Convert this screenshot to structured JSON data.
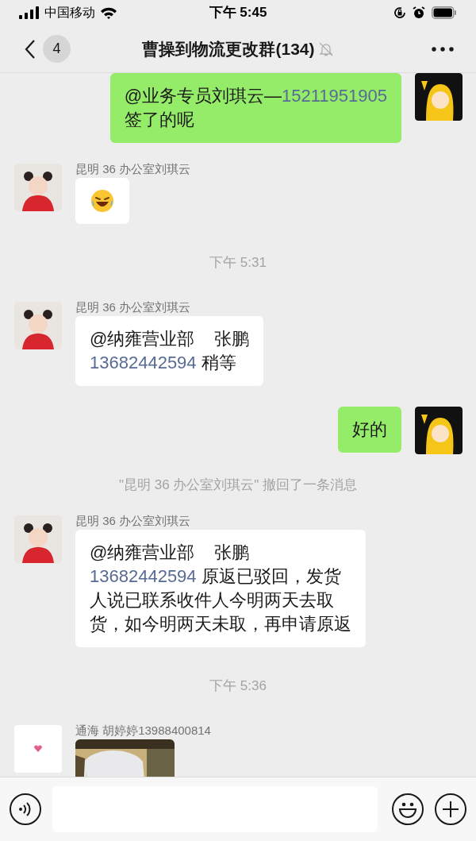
{
  "status_bar": {
    "carrier": "中国移动",
    "time": "下午 5:45"
  },
  "header": {
    "unread": "4",
    "title": "曹操到物流更改群(134)",
    "muted": true
  },
  "messages": [
    {
      "kind": "outgoing",
      "avatar": {
        "kind": "cartoon"
      },
      "lines": [
        [
          {
            "text": "@业务专员刘琪云—"
          },
          {
            "text": "15211951905",
            "link": true
          }
        ],
        [
          {
            "text": "签了的呢"
          }
        ]
      ]
    },
    {
      "kind": "sticker",
      "sender": "昆明 36 办公室刘琪云",
      "avatar": {
        "kind": "girl"
      }
    },
    {
      "kind": "time",
      "text": "下午 5:31"
    },
    {
      "kind": "incoming",
      "sender": "昆明 36 办公室刘琪云",
      "avatar": {
        "kind": "girl"
      },
      "lines": [
        [
          {
            "text": "@纳雍营业部    张鹏"
          }
        ],
        [
          {
            "text": "13682442594",
            "link": true
          },
          {
            "text": " 稍等"
          }
        ]
      ]
    },
    {
      "kind": "outgoing",
      "avatar": {
        "kind": "cartoon"
      },
      "lines": [
        [
          {
            "text": "好的"
          }
        ]
      ]
    },
    {
      "kind": "system",
      "text": "\"昆明 36 办公室刘琪云\" 撤回了一条消息"
    },
    {
      "kind": "incoming",
      "sender": "昆明 36 办公室刘琪云",
      "avatar": {
        "kind": "girl"
      },
      "lines": [
        [
          {
            "text": "@纳雍营业部    张鹏"
          }
        ],
        [
          {
            "text": "13682442594",
            "link": true
          },
          {
            "text": " 原返已驳回，发货"
          }
        ],
        [
          {
            "text": "人说已联系收件人今明两天去取"
          }
        ],
        [
          {
            "text": "货，如今明两天未取，再申请原返"
          }
        ]
      ]
    },
    {
      "kind": "time",
      "text": "下午 5:36"
    },
    {
      "sender": "通海 胡婷婷13988400814",
      "avatar": {
        "kind": "heart"
      }
    }
  ]
}
